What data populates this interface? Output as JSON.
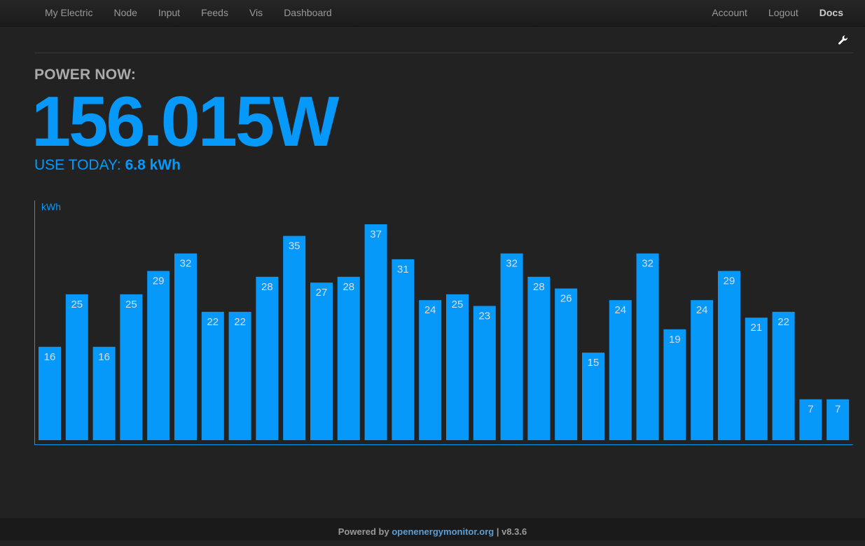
{
  "nav": {
    "left": [
      "My Electric",
      "Node",
      "Input",
      "Feeds",
      "Vis",
      "Dashboard"
    ],
    "right": [
      "Account",
      "Logout",
      "Docs"
    ]
  },
  "power": {
    "label": "POWER NOW:",
    "value": "156.015W"
  },
  "use_today": {
    "label": "USE TODAY: ",
    "value": "6.8 kWh"
  },
  "colors": {
    "accent": "#0699fa",
    "background": "#222222",
    "bar_label": "#dddddd"
  },
  "chart_data": {
    "type": "bar",
    "ylabel": "kWh",
    "values": [
      16,
      25,
      16,
      25,
      29,
      32,
      22,
      22,
      28,
      35,
      27,
      28,
      37,
      31,
      24,
      25,
      23,
      32,
      28,
      26,
      15,
      24,
      32,
      19,
      24,
      29,
      21,
      22,
      7,
      7
    ],
    "ylim": [
      0,
      37
    ],
    "data_labels": true,
    "grid": false
  },
  "footer": {
    "prefix": "Powered by ",
    "link": "openenergymonitor.org",
    "suffix": " | v8.3.6"
  }
}
